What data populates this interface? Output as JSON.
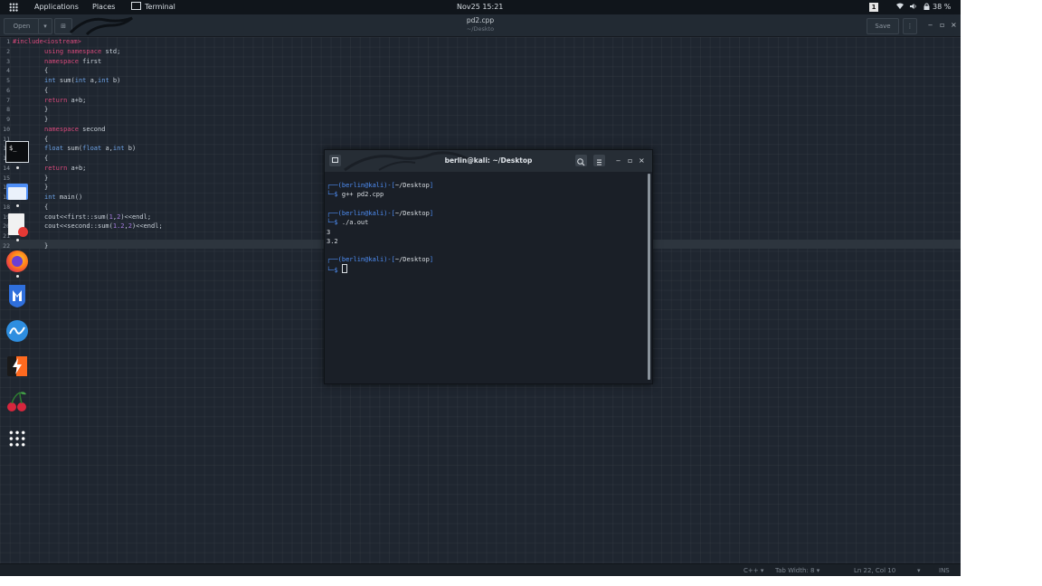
{
  "topbar": {
    "applications": "Applications",
    "places": "Places",
    "terminal": "Terminal",
    "clock": "Nov25  15:21",
    "workspace": "1",
    "battery": "38 %"
  },
  "editor": {
    "open_label": "Open",
    "save_label": "Save",
    "file_title": "pd2.cpp",
    "file_path": "~/Deskto",
    "line_numbers": [
      "1",
      "2",
      "3",
      "4",
      "5",
      "6",
      "7",
      "8",
      "9",
      "10",
      "11",
      "12",
      "13",
      "14",
      "15",
      "16",
      "17",
      "18",
      "19",
      "20",
      "21",
      "22"
    ]
  },
  "terminal": {
    "title": "berlin@kali: ~/Desktop",
    "prompt_user": "berlin@kali",
    "prompt_path": "~/Desktop",
    "cmd1": "g++ pd2.cpp",
    "cmd2": "./a.out",
    "output1": "3",
    "output2": "3.2"
  },
  "statusbar": {
    "language": "C++",
    "tab_width": "Tab Width: 8",
    "position": "Ln 22, Col 10",
    "mode": "INS"
  },
  "dock": {
    "items": [
      "terminal-icon",
      "file-manager-icon",
      "text-editor-icon",
      "firefox-icon",
      "metasploit-icon",
      "wireshark-icon",
      "burpsuite-icon",
      "cherrytree-icon",
      "show-apps-icon"
    ]
  },
  "colors": {
    "background": "#1f2630",
    "keyword": "#d94a7c",
    "type": "#6ea4e8",
    "prompt": "#4f8ff7"
  }
}
